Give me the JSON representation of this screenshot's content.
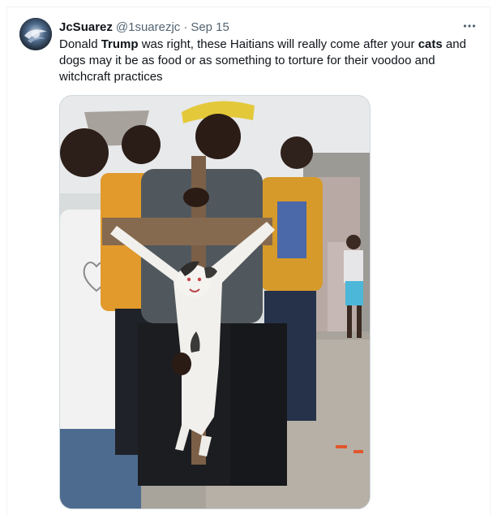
{
  "tweet": {
    "display_name": "JcSuarez",
    "handle": "@1suarezjc",
    "separator": "·",
    "date": "Sep 15",
    "text_segments": [
      "Donald ",
      "Trump",
      " was right, these Haitians will really come after your ",
      "cats",
      " and dogs may it be as food or as something to torture for their voodoo and witchcraft practices"
    ]
  },
  "icons": {
    "more": "more-horizontal-icon",
    "avatar": "avatar-image"
  },
  "colors": {
    "text_primary": "#0f1419",
    "text_secondary": "#536471",
    "border": "#cfd9de"
  }
}
